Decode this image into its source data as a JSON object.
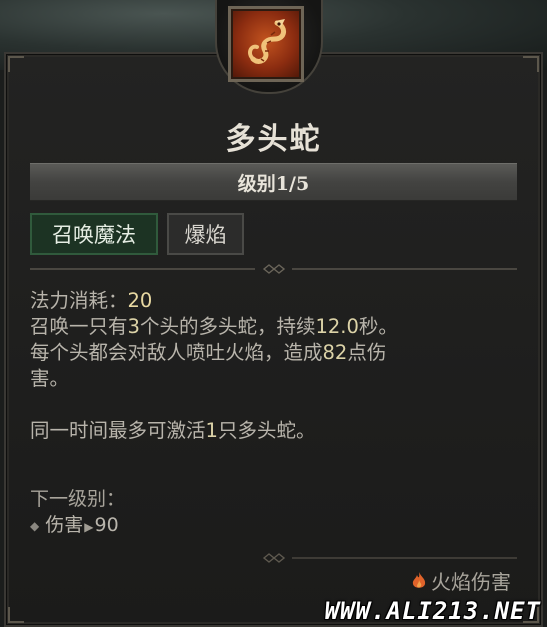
{
  "skill": {
    "name": "多头蛇",
    "level_label": "级别1/5",
    "tags": [
      "召唤魔法",
      "爆焰"
    ],
    "icon": "hydra-skill-icon"
  },
  "description": {
    "cost_label": "法力消耗：",
    "cost_value": "20",
    "line2_a": "召唤一只有",
    "line2_heads": "3",
    "line2_b": "个头的多头蛇，持续",
    "line2_duration": "12.0",
    "line2_c": "秒。",
    "line3_a": "每个头都会对敌人喷吐火焰，造成",
    "line3_damage": "82",
    "line3_b": "点伤",
    "line4": "害。",
    "line5_a": "同一时间最多可激活",
    "line5_count": "1",
    "line5_b": "只多头蛇。"
  },
  "next_level": {
    "heading": "下一级别：",
    "stat_label": "伤害",
    "stat_value": "90"
  },
  "damage_type": {
    "label": "火焰伤害",
    "icon": "fire-icon"
  },
  "watermark": "WWW.ALI213.NET",
  "colors": {
    "highlight": "#e8d9a2",
    "primary_tag_bg": "#1c3323",
    "fire": "#e0632a"
  }
}
